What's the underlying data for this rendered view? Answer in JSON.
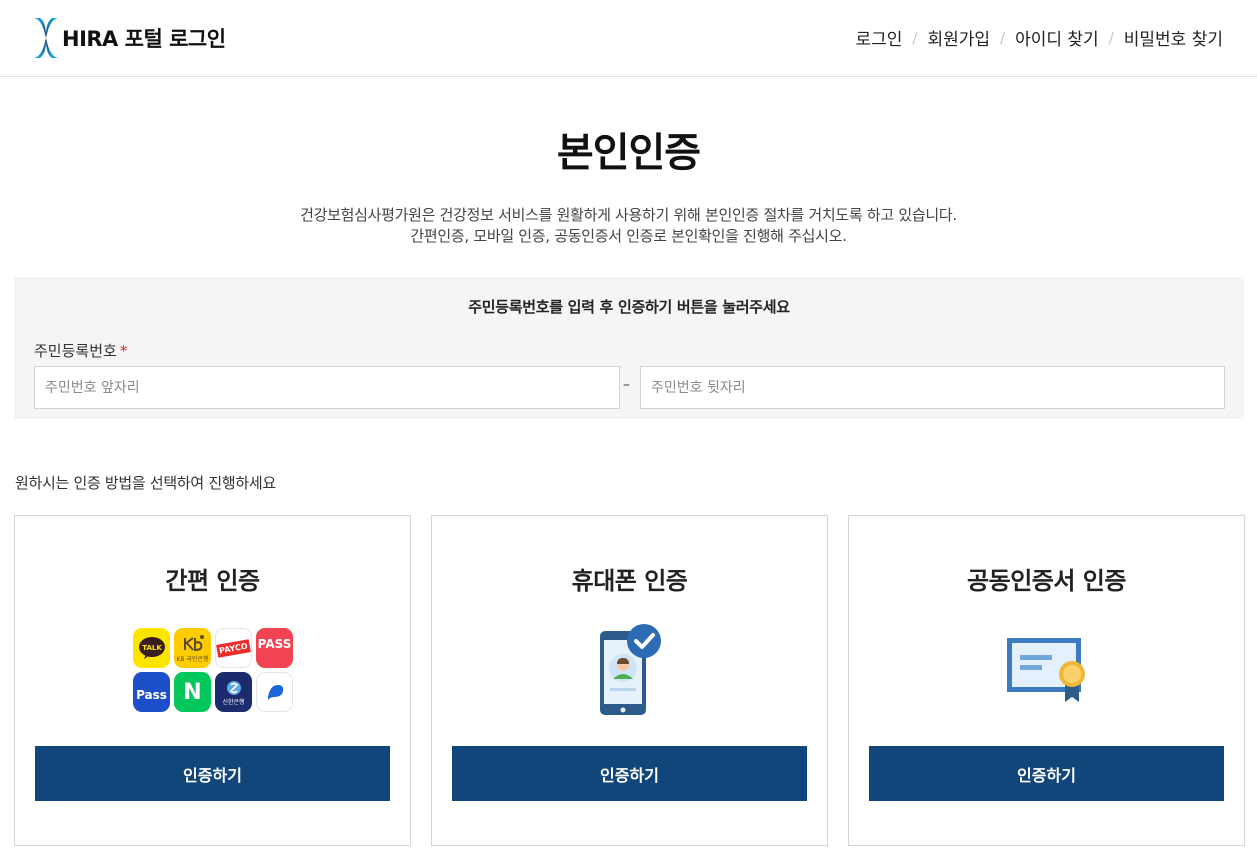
{
  "header": {
    "logo_text": "HIRA 포털 로그인",
    "nav": [
      "로그인",
      "회원가입",
      "아이디 찾기",
      "비밀번호 찾기"
    ],
    "separator": "/"
  },
  "page": {
    "title": "본인인증",
    "description_line1": "건강보험심사평가원은 건강정보 서비스를 원활하게 사용하기 위해 본인인증 절차를 거치도록 하고 있습니다.",
    "description_line2": "간편인증, 모바일 인증, 공동인증서 인증로 본인확인을 진행해 주십시오."
  },
  "rrn": {
    "guide": "주민등록번호를 입력 후 인증하기 버튼을 눌러주세요",
    "label": "주민등록번호",
    "required_mark": "*",
    "front_placeholder": "주민번호 앞자리",
    "back_placeholder": "주민번호 뒷자리",
    "front_value": "",
    "back_value": "",
    "dash": "–"
  },
  "method_guide": "원하시는 인증 방법을 선택하여 진행하세요",
  "cards": [
    {
      "title": "간편 인증",
      "button": "인증하기",
      "apps": [
        {
          "icon": "kakaotalk-icon",
          "text": "TALK",
          "bg": "#fee500",
          "color": "#3a1d1d"
        },
        {
          "icon": "kb-bank-icon",
          "text": "KB 국민은행",
          "bg": "#ffcc00",
          "color": "#5b4a2e"
        },
        {
          "icon": "payco-icon",
          "text": "PAYCO",
          "bg": "#ffffff",
          "color": "#ee2b2b"
        },
        {
          "icon": "pass-icon",
          "text": "PASS",
          "bg": "#f24352",
          "color": "#ffffff"
        },
        {
          "icon": "samsung-pass-icon",
          "text": "Pass",
          "bg": "#1c4fc9",
          "color": "#ffffff"
        },
        {
          "icon": "naver-icon",
          "text": "N",
          "bg": "#03c75a",
          "color": "#ffffff"
        },
        {
          "icon": "shinhan-bank-icon",
          "text": "신한은행",
          "bg": "#1c2a6e",
          "color": "#ffffff"
        },
        {
          "icon": "toss-icon",
          "text": "",
          "bg": "#ffffff",
          "color": "#1b64da"
        }
      ]
    },
    {
      "title": "휴대폰 인증",
      "button": "인증하기"
    },
    {
      "title": "공동인증서 인증",
      "button": "인증하기"
    }
  ],
  "colors": {
    "primary_button": "#11467a",
    "required": "#d9262c",
    "panel_bg": "#f5f5f5"
  }
}
